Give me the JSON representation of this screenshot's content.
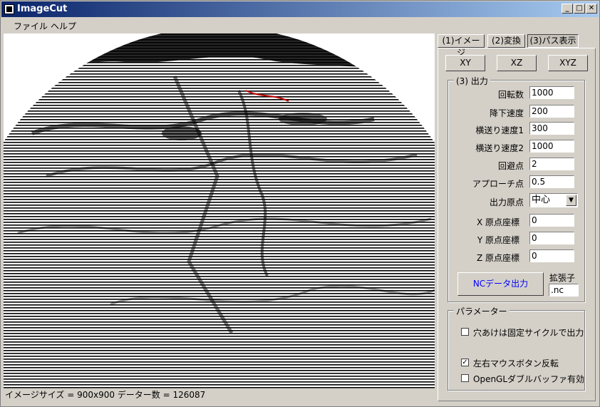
{
  "window": {
    "title": "ImageCut"
  },
  "menu": [
    "ファイル",
    "ヘルプ"
  ],
  "tabs": [
    "(1)イメージ",
    "(2)変換",
    "(3)パス表示"
  ],
  "view_buttons": [
    "XY",
    "XZ",
    "XYZ"
  ],
  "output_group": {
    "title": "(3) 出力",
    "fields": [
      {
        "label": "回転数",
        "value": "1000"
      },
      {
        "label": "降下速度",
        "value": "200"
      },
      {
        "label": "横送り速度1",
        "value": "300"
      },
      {
        "label": "横送り速度2",
        "value": "1000"
      },
      {
        "label": "回避点",
        "value": "2"
      },
      {
        "label": "アプローチ点",
        "value": "0.5"
      }
    ],
    "origin_label": "出力原点",
    "origin_value": "中心",
    "coords": [
      {
        "label": "X 原点座標",
        "value": "0"
      },
      {
        "label": "Y 原点座標",
        "value": "0"
      },
      {
        "label": "Z 原点座標",
        "value": "0"
      }
    ],
    "nc_button": "NCデータ出力",
    "ext_label": "拡張子",
    "ext_value": ".nc"
  },
  "param_group": {
    "title": "パラメーター",
    "checks": [
      {
        "label": "穴あけは固定サイクルで出力",
        "checked": false
      },
      {
        "label": "左右マウスボタン反転",
        "checked": true
      },
      {
        "label": "OpenGLダブルバッファ有効",
        "checked": false
      }
    ]
  },
  "status": "イメージサイズ = 900x900 データー数 = 126087",
  "colors": {
    "titlebar": "#0a246a",
    "nc_button_text": "#0000ff",
    "face": "#d4d0c8"
  }
}
